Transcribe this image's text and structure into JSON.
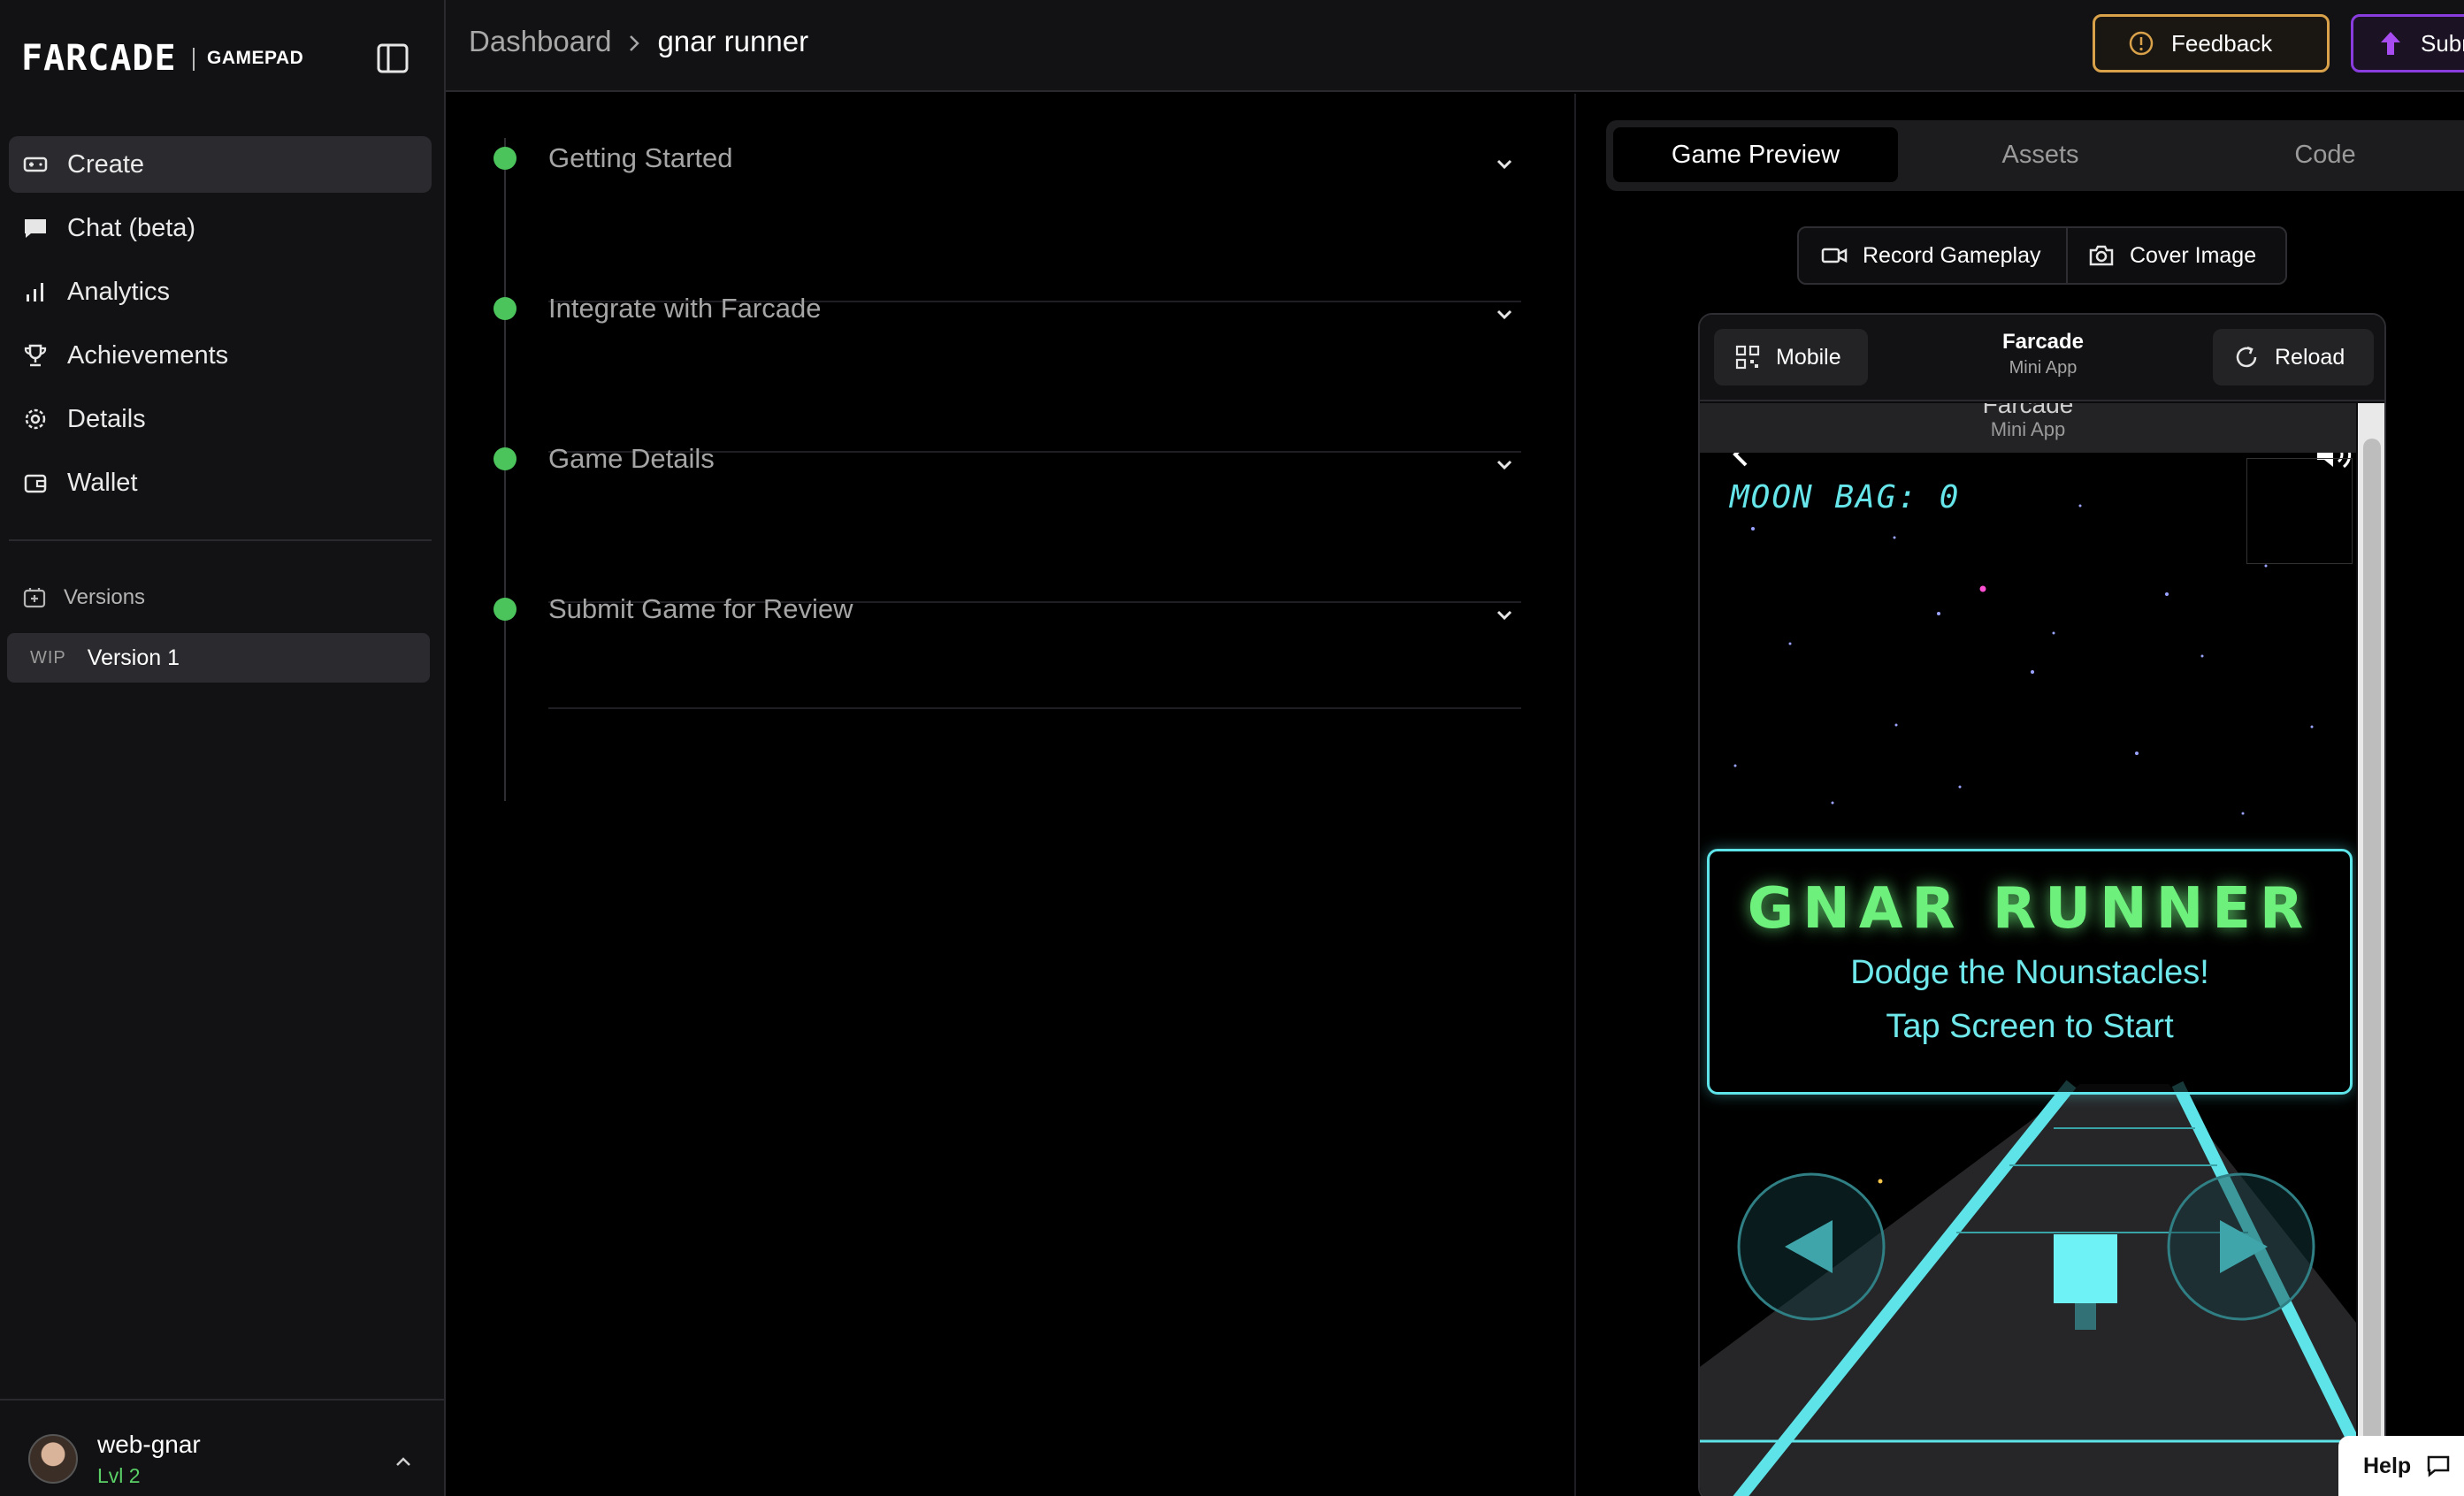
{
  "app": {
    "logo_text": "FARCADE",
    "logo_sub": "GAMEPAD"
  },
  "sidebar": {
    "nav": [
      {
        "label": "Create",
        "icon": "gamepad-icon",
        "active": true
      },
      {
        "label": "Chat (beta)",
        "icon": "chat-icon",
        "active": false
      },
      {
        "label": "Analytics",
        "icon": "bar-chart-icon",
        "active": false
      },
      {
        "label": "Achievements",
        "icon": "trophy-icon",
        "active": false
      },
      {
        "label": "Details",
        "icon": "gear-icon",
        "active": false
      },
      {
        "label": "Wallet",
        "icon": "wallet-icon",
        "active": false
      }
    ],
    "versions_heading": "Versions",
    "versions": [
      {
        "tag": "WIP",
        "label": "Version 1"
      }
    ],
    "user": {
      "name": "web-gnar",
      "level": "Lvl 2"
    }
  },
  "topbar": {
    "breadcrumb": [
      "Dashboard",
      "gnar runner"
    ],
    "feedback_label": "Feedback",
    "submit_label": "Submit"
  },
  "steps": [
    {
      "title": "Getting Started"
    },
    {
      "title": "Integrate with Farcade"
    },
    {
      "title": "Game Details"
    },
    {
      "title": "Submit Game for Review"
    }
  ],
  "preview": {
    "tabs": [
      "Game Preview",
      "Assets",
      "Code"
    ],
    "active_tab": "Game Preview",
    "record_label": "Record Gameplay",
    "cover_label": "Cover Image",
    "device": {
      "mode_label": "Mobile",
      "title": "Farcade",
      "subtitle": "Mini App",
      "reload_label": "Reload"
    },
    "game": {
      "header_title": "Farcade",
      "header_subtitle": "Mini App",
      "moon_bag": "MOON BAG: 0",
      "title": "GNAR RUNNER",
      "line1": "Dodge the Nounstacles!",
      "line2": "Tap Screen to Start"
    }
  },
  "help_label": "Help",
  "colors": {
    "accent_green": "#4cc45c",
    "feedback_border": "#d9a24a",
    "submit_border": "#8a3ddf",
    "neon_cyan": "#5de3e8",
    "neon_green": "#6ef07d"
  }
}
